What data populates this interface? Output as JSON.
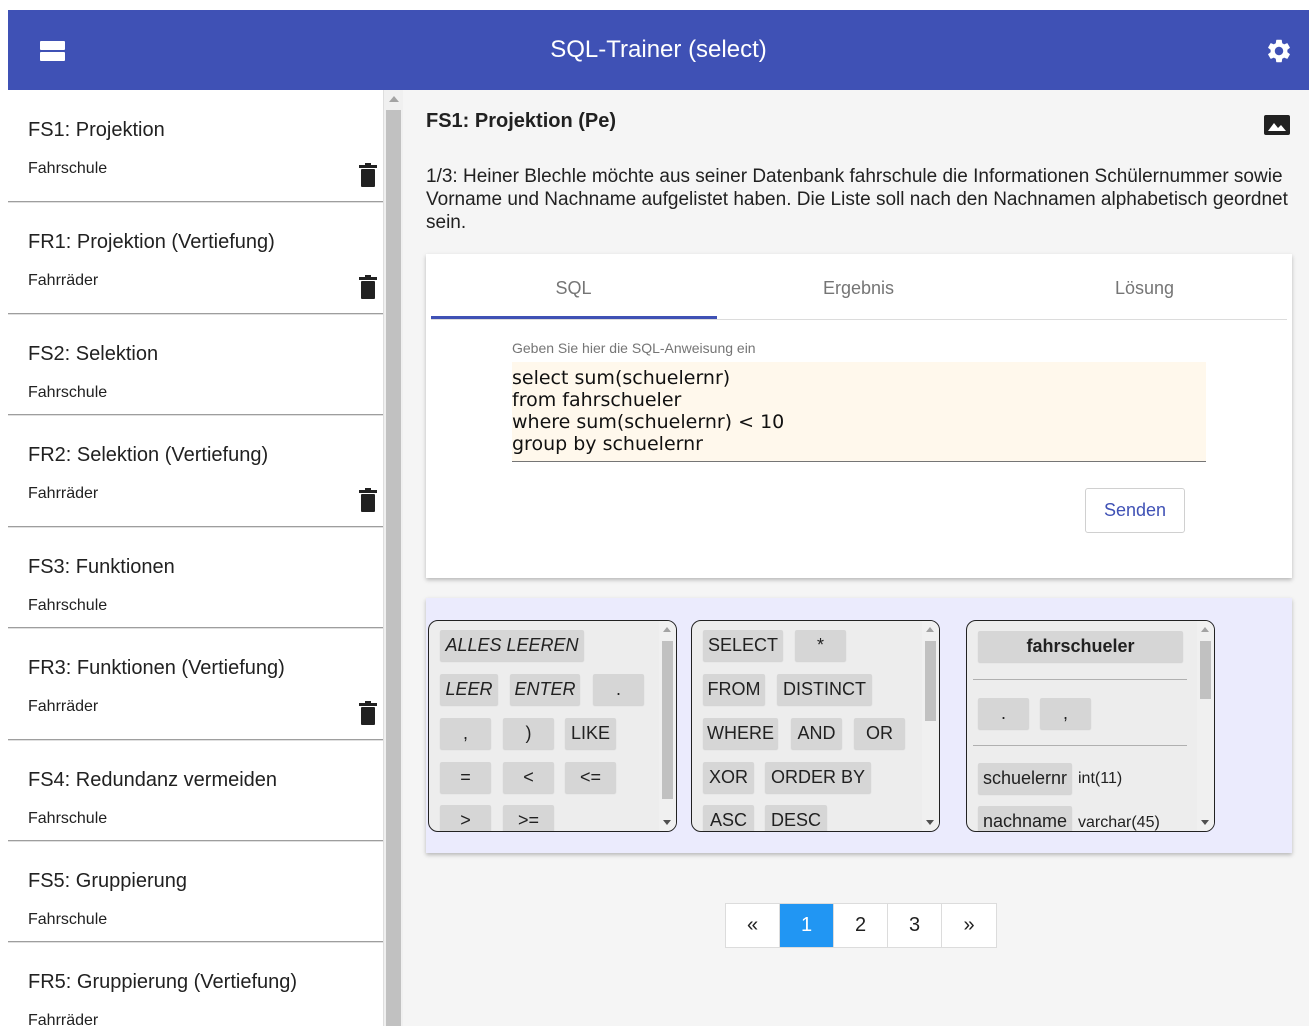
{
  "header": {
    "title": "SQL-Trainer (select)"
  },
  "sidebar": {
    "items": [
      {
        "title": "FS1: Projektion",
        "subtitle": "Fahrschule",
        "deletable": true
      },
      {
        "title": "FR1: Projektion (Vertiefung)",
        "subtitle": "Fahrräder",
        "deletable": true
      },
      {
        "title": "FS2: Selektion",
        "subtitle": "Fahrschule",
        "deletable": false
      },
      {
        "title": "FR2: Selektion (Vertiefung)",
        "subtitle": "Fahrräder",
        "deletable": true
      },
      {
        "title": "FS3: Funktionen",
        "subtitle": "Fahrschule",
        "deletable": false
      },
      {
        "title": "FR3: Funktionen (Vertiefung)",
        "subtitle": "Fahrräder",
        "deletable": true
      },
      {
        "title": "FS4: Redundanz vermeiden",
        "subtitle": "Fahrschule",
        "deletable": false
      },
      {
        "title": "FS5: Gruppierung",
        "subtitle": "Fahrschule",
        "deletable": false
      },
      {
        "title": "FR5: Gruppierung (Vertiefung)",
        "subtitle": "Fahrräder",
        "deletable": false
      }
    ]
  },
  "task": {
    "title": "FS1: Projektion (Pe)",
    "description": "1/3: Heiner Blechle möchte aus seiner Datenbank fahrschule die Informationen Schülernummer sowie Vorname und Nachname aufgelistet haben. Die Liste soll nach den Nachnamen alphabetisch geordnet sein."
  },
  "tabs": [
    "SQL",
    "Ergebnis",
    "Lösung"
  ],
  "editor": {
    "label": "Geben Sie hier die SQL-Anweisung ein",
    "value": "select sum(schuelernr)\nfrom fahrschueler\nwhere sum(schuelernr) < 10\ngroup by schuelernr",
    "send_label": "Senden"
  },
  "keyboard": {
    "controls": [
      "ALLES LEEREN",
      "LEER",
      "ENTER",
      ".",
      ",",
      ")",
      "LIKE",
      "=",
      "<",
      "<=",
      ">",
      ">="
    ],
    "keywords": [
      "SELECT",
      "*",
      "FROM",
      "DISTINCT",
      "WHERE",
      "AND",
      "OR",
      "XOR",
      "ORDER BY",
      "ASC",
      "DESC"
    ],
    "table": {
      "name": "fahrschueler",
      "symbols": [
        ".",
        ","
      ],
      "columns": [
        {
          "name": "schuelernr",
          "type": "int(11)"
        },
        {
          "name": "nachname",
          "type": "varchar(45)"
        }
      ]
    }
  },
  "pagination": {
    "prev": "«",
    "pages": [
      "1",
      "2",
      "3"
    ],
    "next": "»",
    "active": "1"
  },
  "colors": {
    "primary": "#3f51b5",
    "active_page": "#2196f3",
    "editor_bg": "#fff8ec",
    "keyboard_bg": "#ebebfd"
  }
}
